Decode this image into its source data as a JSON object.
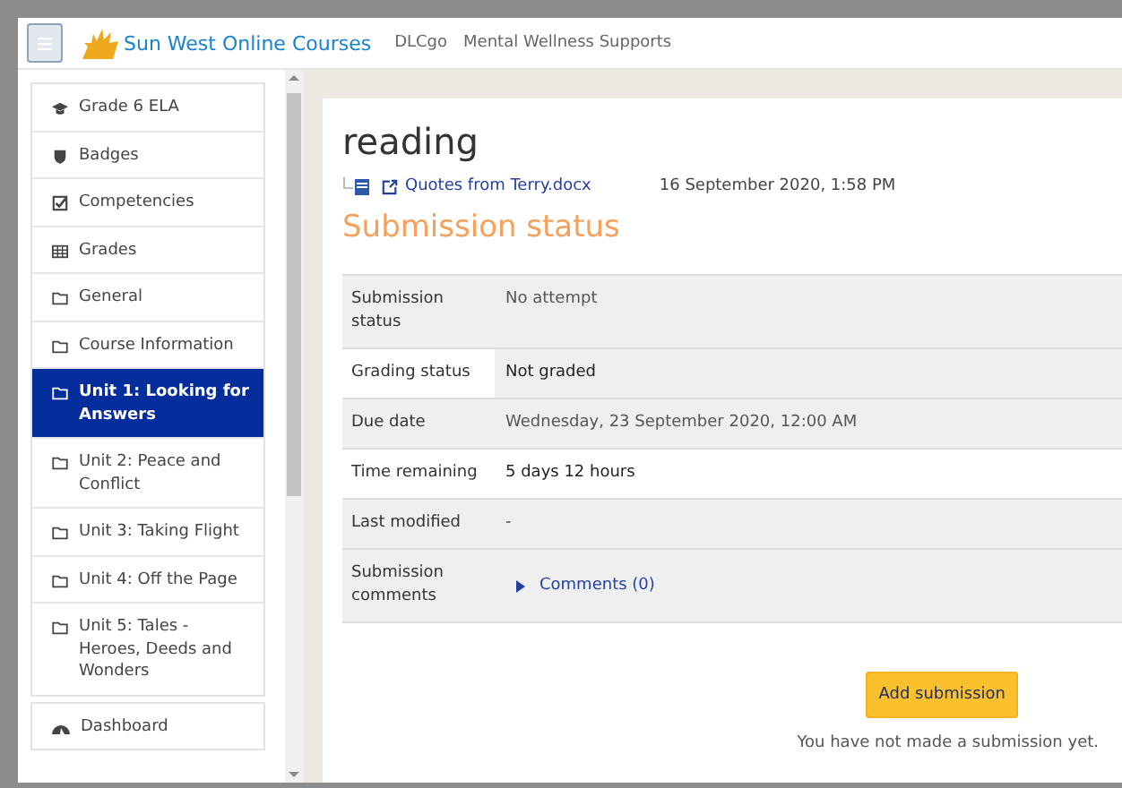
{
  "header": {
    "site_name": "Sun West Online Courses",
    "links": [
      "DLCgo",
      "Mental Wellness Supports"
    ]
  },
  "sidebar": {
    "items": [
      {
        "label": "Grade 6 ELA",
        "kind": "course",
        "selected": false
      },
      {
        "label": "Badges",
        "kind": "badges",
        "selected": false
      },
      {
        "label": "Competencies",
        "kind": "competencies",
        "selected": false
      },
      {
        "label": "Grades",
        "kind": "grades",
        "selected": false
      },
      {
        "label": "General",
        "kind": "section",
        "selected": false
      },
      {
        "label": "Course Information",
        "kind": "section",
        "selected": false
      },
      {
        "label": "Unit 1: Looking for Answers",
        "kind": "section",
        "selected": true
      },
      {
        "label": "Unit 2: Peace and Conflict",
        "kind": "section",
        "selected": false
      },
      {
        "label": "Unit 3: Taking Flight",
        "kind": "section",
        "selected": false
      },
      {
        "label": "Unit 4: Off the Page",
        "kind": "section",
        "selected": false
      },
      {
        "label": "Unit 5: Tales - Heroes, Deeds and Wonders",
        "kind": "section",
        "selected": false
      }
    ],
    "footer_items": [
      {
        "label": "Dashboard",
        "kind": "dashboard",
        "selected": false
      }
    ]
  },
  "content": {
    "title": "reading",
    "file": {
      "name": "Quotes from Terry.docx",
      "date": "16 September 2020, 1:58 PM"
    },
    "section_title": "Submission status",
    "rows": [
      {
        "label": "Submission status",
        "value": "No attempt",
        "kind": "text",
        "label_shaded": true,
        "value_shaded": true
      },
      {
        "label": "Grading status",
        "value": "Not graded",
        "kind": "text",
        "label_shaded": false,
        "value_shaded": true
      },
      {
        "label": "Due date",
        "value": "Wednesday, 23 September 2020, 12:00 AM",
        "kind": "text",
        "label_shaded": true,
        "value_shaded": true
      },
      {
        "label": "Time remaining",
        "value": "5 days 12 hours",
        "kind": "text",
        "label_shaded": false,
        "value_shaded": false
      },
      {
        "label": "Last modified",
        "value": "-",
        "kind": "text",
        "label_shaded": true,
        "value_shaded": true
      },
      {
        "label": "Submission comments",
        "value": "Comments (0)",
        "kind": "comments",
        "label_shaded": true,
        "value_shaded": true
      }
    ],
    "button": "Add submission",
    "note": "You have not made a submission yet."
  }
}
